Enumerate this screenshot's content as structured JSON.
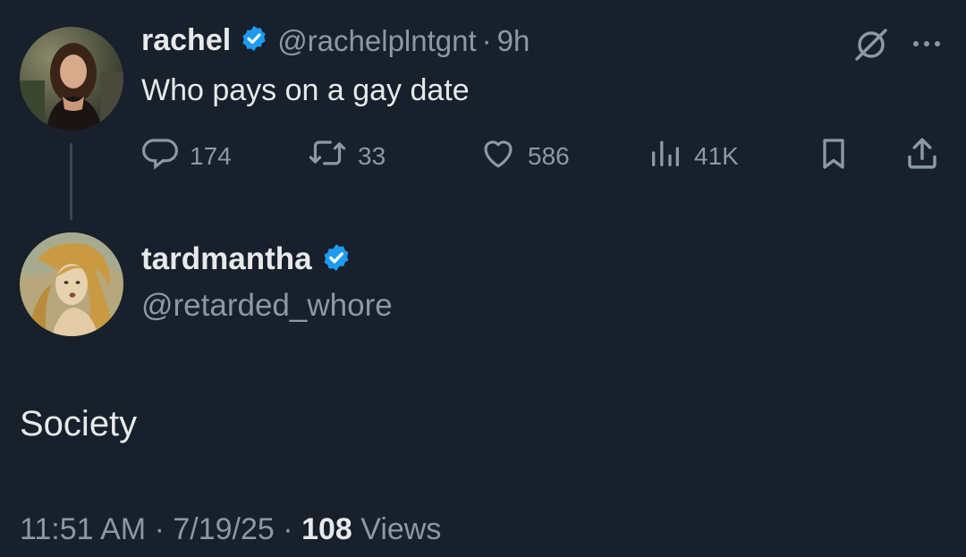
{
  "quoted_tweet": {
    "author_name": "rachel",
    "verified": true,
    "handle": "@rachelplntgnt",
    "separator": "·",
    "time_ago": "9h",
    "text": "Who pays on a gay date",
    "actions": {
      "replies": "174",
      "reposts": "33",
      "likes": "586",
      "views": "41K"
    }
  },
  "reply_tweet": {
    "author_name": "tardmantha",
    "verified": true,
    "handle": "@retarded_whore",
    "text": "Society",
    "time": "11:51 AM",
    "date": "7/19/25",
    "separator": "·",
    "views_count": "108",
    "views_label": "Views"
  },
  "icons": {
    "verified": "verified-badge-icon",
    "grok": "grok-icon",
    "more": "more-icon",
    "reply": "reply-icon",
    "repost": "repost-icon",
    "like": "heart-icon",
    "views": "views-bar-chart-icon",
    "bookmark": "bookmark-icon",
    "share": "share-icon"
  },
  "colors": {
    "background": "#17202b",
    "text": "#e7e9ea",
    "muted": "#8b98a5",
    "verified_blue": "#1d9bf0"
  }
}
